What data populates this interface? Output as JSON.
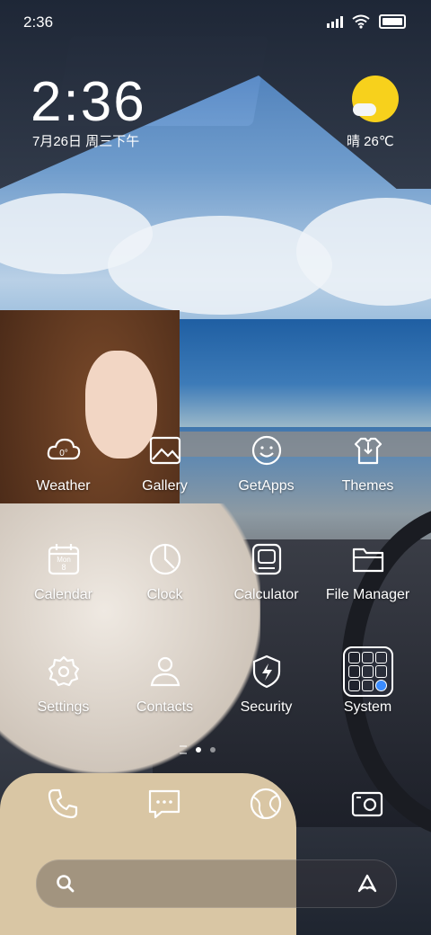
{
  "status": {
    "time": "2:36"
  },
  "clock": {
    "time": "2:36",
    "date": "7月26日 周三下午"
  },
  "weather": {
    "text": "晴 26℃",
    "icon": "sunny-cloud-icon",
    "sun_color": "#f7d11c"
  },
  "apps": [
    {
      "label": "Weather",
      "icon": "weather-cloud-icon",
      "badge": "0°"
    },
    {
      "label": "Gallery",
      "icon": "gallery-icon"
    },
    {
      "label": "GetApps",
      "icon": "getapps-icon"
    },
    {
      "label": "Themes",
      "icon": "themes-icon"
    },
    {
      "label": "Calendar",
      "icon": "calendar-icon",
      "badge_top": "Mon",
      "badge_num": "8"
    },
    {
      "label": "Clock",
      "icon": "clock-icon"
    },
    {
      "label": "Calculator",
      "icon": "calculator-icon"
    },
    {
      "label": "File Manager",
      "icon": "folder-icon"
    },
    {
      "label": "Settings",
      "icon": "gear-icon"
    },
    {
      "label": "Contacts",
      "icon": "contacts-icon"
    },
    {
      "label": "Security",
      "icon": "shield-icon"
    },
    {
      "label": "System",
      "icon": "system-folder-icon"
    }
  ],
  "page_indicator": {
    "pages": 2,
    "active": 1
  },
  "dock": [
    {
      "name": "phone",
      "icon": "phone-icon"
    },
    {
      "name": "messages",
      "icon": "message-icon"
    },
    {
      "name": "browser",
      "icon": "globe-icon"
    },
    {
      "name": "camera",
      "icon": "camera-icon"
    }
  ],
  "search": {
    "left_icon": "search-icon",
    "right_icon": "assistant-icon"
  }
}
